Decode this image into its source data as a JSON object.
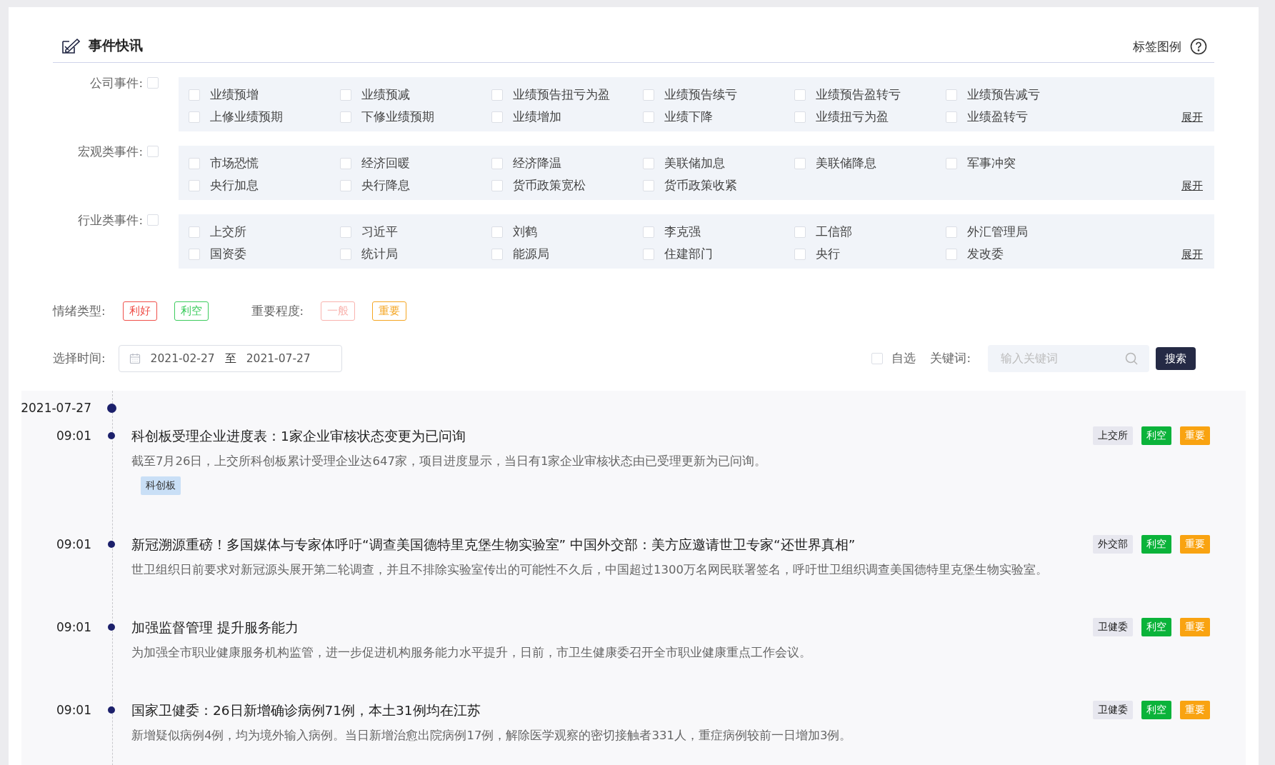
{
  "header": {
    "title": "事件快讯",
    "legend_link": "标签图例"
  },
  "categories": [
    {
      "label": "公司事件:",
      "checked": false,
      "expand": "展开",
      "items": [
        {
          "label": "业绩预增",
          "checked": false
        },
        {
          "label": "业绩预减",
          "checked": false
        },
        {
          "label": "业绩预告扭亏为盈",
          "checked": false
        },
        {
          "label": "业绩预告续亏",
          "checked": false
        },
        {
          "label": "业绩预告盈转亏",
          "checked": false
        },
        {
          "label": "业绩预告减亏",
          "checked": false
        },
        {
          "label": "上修业绩预期",
          "checked": false
        },
        {
          "label": "下修业绩预期",
          "checked": false
        },
        {
          "label": "业绩增加",
          "checked": false
        },
        {
          "label": "业绩下降",
          "checked": false
        },
        {
          "label": "业绩扭亏为盈",
          "checked": false
        },
        {
          "label": "业绩盈转亏",
          "checked": false
        }
      ]
    },
    {
      "label": "宏观类事件:",
      "checked": false,
      "expand": "展开",
      "items": [
        {
          "label": "市场恐慌",
          "checked": false
        },
        {
          "label": "经济回暖",
          "checked": false
        },
        {
          "label": "经济降温",
          "checked": false
        },
        {
          "label": "美联储加息",
          "checked": false
        },
        {
          "label": "美联储降息",
          "checked": false
        },
        {
          "label": "军事冲突",
          "checked": false
        },
        {
          "label": "央行加息",
          "checked": false
        },
        {
          "label": "央行降息",
          "checked": false
        },
        {
          "label": "货币政策宽松",
          "checked": false
        },
        {
          "label": "货币政策收紧",
          "checked": false
        }
      ]
    },
    {
      "label": "行业类事件:",
      "checked": false,
      "expand": "展开",
      "items": [
        {
          "label": "上交所",
          "checked": false
        },
        {
          "label": "习近平",
          "checked": false
        },
        {
          "label": "刘鹤",
          "checked": false
        },
        {
          "label": "李克强",
          "checked": false
        },
        {
          "label": "工信部",
          "checked": false
        },
        {
          "label": "外汇管理局",
          "checked": false
        },
        {
          "label": "国资委",
          "checked": false
        },
        {
          "label": "统计局",
          "checked": false
        },
        {
          "label": "能源局",
          "checked": false
        },
        {
          "label": "住建部门",
          "checked": false
        },
        {
          "label": "央行",
          "checked": false
        },
        {
          "label": "发改委",
          "checked": false
        }
      ]
    }
  ],
  "filters": [
    {
      "label": "情绪类型:",
      "tags": [
        {
          "label": "利好",
          "color": "#f0504a"
        },
        {
          "label": "利空",
          "color": "#3dcc5e"
        }
      ]
    },
    {
      "label": "重要程度:",
      "tags": [
        {
          "label": "一般",
          "color": "#f9b3ae"
        },
        {
          "label": "重要",
          "color": "#f5a623"
        }
      ]
    }
  ],
  "time": {
    "label": "选择时间:",
    "start": "2021-02-27",
    "separator": "至",
    "end": "2021-07-27"
  },
  "self_select": {
    "label": "自选",
    "checked": false
  },
  "keyword": {
    "label": "关键词:",
    "placeholder": "输入关键词"
  },
  "search_button": "搜索",
  "timeline": {
    "date": "2021-07-27",
    "events": [
      {
        "time": "09:01",
        "title": "科创板受理企业进度表：1家企业审核状态变更为已问询",
        "summary": "截至7月26日，上交所科创板累计受理企业达647家，项目进度显示，当日有1家企业审核状态由已受理更新为已问询。",
        "keywords": [
          "科创板"
        ],
        "tags": [
          {
            "kind": "source",
            "label": "上交所"
          },
          {
            "kind": "sentiment",
            "label": "利空",
            "color": "#0bb33a"
          },
          {
            "kind": "importance",
            "label": "重要",
            "color": "#f9a311"
          }
        ]
      },
      {
        "time": "09:01",
        "title": "新冠溯源重磅！多国媒体与专家体呼吁“调查美国德特里克堡生物实验室” 中国外交部：美方应邀请世卫专家“还世界真相”",
        "summary": "世卫组织日前要求对新冠源头展开第二轮调查，并且不排除实验室传出的可能性不久后，中国超过1300万名网民联署签名，呼吁世卫组织调查美国德特里克堡生物实验室。",
        "tags": [
          {
            "kind": "source",
            "label": "外交部"
          },
          {
            "kind": "sentiment",
            "label": "利空",
            "color": "#0bb33a"
          },
          {
            "kind": "importance",
            "label": "重要",
            "color": "#f9a311"
          }
        ]
      },
      {
        "time": "09:01",
        "title": "加强监督管理 提升服务能力",
        "summary": "为加强全市职业健康服务机构监管，进一步促进机构服务能力水平提升，日前，市卫生健康委召开全市职业健康重点工作会议。",
        "tags": [
          {
            "kind": "source",
            "label": "卫健委"
          },
          {
            "kind": "sentiment",
            "label": "利空",
            "color": "#0bb33a"
          },
          {
            "kind": "importance",
            "label": "重要",
            "color": "#f9a311"
          }
        ]
      },
      {
        "time": "09:01",
        "title": "国家卫健委：26日新增确诊病例71例，本土31例均在江苏",
        "summary": "新增疑似病例4例，均为境外输入病例。当日新增治愈出院病例17例，解除医学观察的密切接触者331人，重症病例较前一日增加3例。",
        "tags": [
          {
            "kind": "source",
            "label": "卫健委"
          },
          {
            "kind": "sentiment",
            "label": "利空",
            "color": "#0bb33a"
          },
          {
            "kind": "importance",
            "label": "重要",
            "color": "#f9a311"
          }
        ]
      }
    ]
  }
}
